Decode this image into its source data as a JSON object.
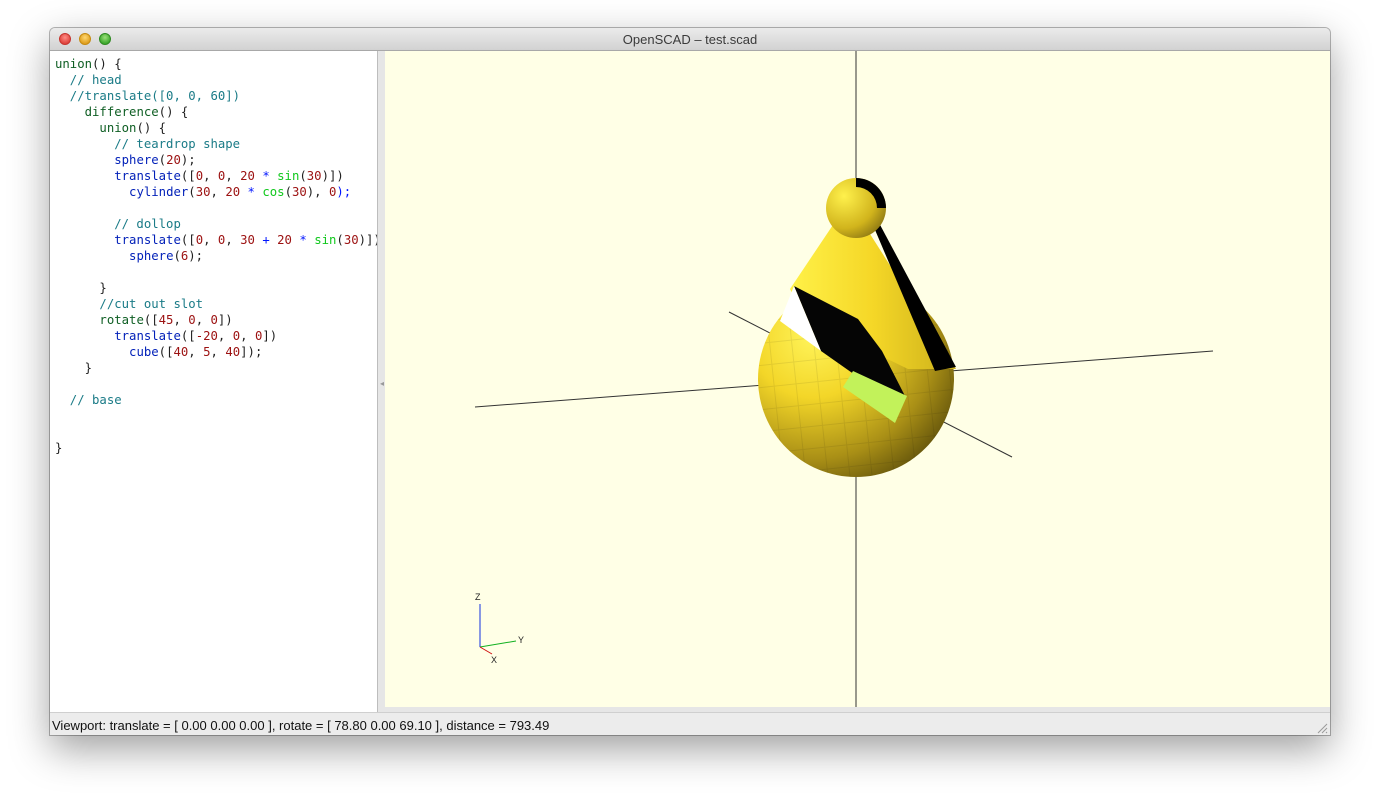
{
  "window": {
    "title": "OpenSCAD – test.scad"
  },
  "editor": {
    "lines": [
      [
        {
          "t": "union",
          "c": "kw"
        },
        {
          "t": "() {",
          "c": "tx"
        }
      ],
      [
        {
          "t": "  // head",
          "c": "cm"
        }
      ],
      [
        {
          "t": "  //translate([0, 0, 60])",
          "c": "cm"
        }
      ],
      [
        {
          "t": "    ",
          "c": "tx"
        },
        {
          "t": "difference",
          "c": "kw"
        },
        {
          "t": "() {",
          "c": "tx"
        }
      ],
      [
        {
          "t": "      ",
          "c": "tx"
        },
        {
          "t": "union",
          "c": "kw"
        },
        {
          "t": "() {",
          "c": "tx"
        }
      ],
      [
        {
          "t": "        // teardrop shape",
          "c": "cm"
        }
      ],
      [
        {
          "t": "        ",
          "c": "tx"
        },
        {
          "t": "sphere",
          "c": "fn"
        },
        {
          "t": "(",
          "c": "tx"
        },
        {
          "t": "20",
          "c": "nm"
        },
        {
          "t": ");",
          "c": "tx"
        }
      ],
      [
        {
          "t": "        ",
          "c": "tx"
        },
        {
          "t": "translate",
          "c": "fn"
        },
        {
          "t": "([",
          "c": "tx"
        },
        {
          "t": "0",
          "c": "nm"
        },
        {
          "t": ", ",
          "c": "tx"
        },
        {
          "t": "0",
          "c": "nm"
        },
        {
          "t": ", ",
          "c": "tx"
        },
        {
          "t": "20",
          "c": "nm"
        },
        {
          "t": " ",
          "c": "tx"
        },
        {
          "t": "*",
          "c": "op"
        },
        {
          "t": " ",
          "c": "tx"
        },
        {
          "t": "sin",
          "c": "mt"
        },
        {
          "t": "(",
          "c": "tx"
        },
        {
          "t": "30",
          "c": "nm"
        },
        {
          "t": ")])",
          "c": "tx"
        }
      ],
      [
        {
          "t": "          ",
          "c": "tx"
        },
        {
          "t": "cylinder",
          "c": "fn"
        },
        {
          "t": "(",
          "c": "tx"
        },
        {
          "t": "30",
          "c": "nm"
        },
        {
          "t": ", ",
          "c": "tx"
        },
        {
          "t": "20",
          "c": "nm"
        },
        {
          "t": " ",
          "c": "tx"
        },
        {
          "t": "*",
          "c": "op"
        },
        {
          "t": " ",
          "c": "tx"
        },
        {
          "t": "cos",
          "c": "mt"
        },
        {
          "t": "(",
          "c": "tx"
        },
        {
          "t": "30",
          "c": "nm"
        },
        {
          "t": "), ",
          "c": "tx"
        },
        {
          "t": "0",
          "c": "nm"
        },
        {
          "t": ");",
          "c": "op"
        }
      ],
      [
        {
          "t": "",
          "c": "tx"
        }
      ],
      [
        {
          "t": "        // dollop",
          "c": "cm"
        }
      ],
      [
        {
          "t": "        ",
          "c": "tx"
        },
        {
          "t": "translate",
          "c": "fn"
        },
        {
          "t": "([",
          "c": "tx"
        },
        {
          "t": "0",
          "c": "nm"
        },
        {
          "t": ", ",
          "c": "tx"
        },
        {
          "t": "0",
          "c": "nm"
        },
        {
          "t": ", ",
          "c": "tx"
        },
        {
          "t": "30",
          "c": "nm"
        },
        {
          "t": " ",
          "c": "tx"
        },
        {
          "t": "+",
          "c": "op"
        },
        {
          "t": " ",
          "c": "tx"
        },
        {
          "t": "20",
          "c": "nm"
        },
        {
          "t": " ",
          "c": "tx"
        },
        {
          "t": "*",
          "c": "op"
        },
        {
          "t": " ",
          "c": "tx"
        },
        {
          "t": "sin",
          "c": "mt"
        },
        {
          "t": "(",
          "c": "tx"
        },
        {
          "t": "30",
          "c": "nm"
        },
        {
          "t": ")])",
          "c": "tx"
        }
      ],
      [
        {
          "t": "          ",
          "c": "tx"
        },
        {
          "t": "sphere",
          "c": "fn"
        },
        {
          "t": "(",
          "c": "tx"
        },
        {
          "t": "6",
          "c": "nm"
        },
        {
          "t": ");",
          "c": "tx"
        }
      ],
      [
        {
          "t": "",
          "c": "tx"
        }
      ],
      [
        {
          "t": "      }",
          "c": "tx"
        }
      ],
      [
        {
          "t": "      //cut out slot",
          "c": "cm"
        }
      ],
      [
        {
          "t": "      ",
          "c": "tx"
        },
        {
          "t": "rotate",
          "c": "kw"
        },
        {
          "t": "([",
          "c": "tx"
        },
        {
          "t": "45",
          "c": "nm"
        },
        {
          "t": ", ",
          "c": "tx"
        },
        {
          "t": "0",
          "c": "nm"
        },
        {
          "t": ", ",
          "c": "tx"
        },
        {
          "t": "0",
          "c": "nm"
        },
        {
          "t": "])",
          "c": "tx"
        }
      ],
      [
        {
          "t": "        ",
          "c": "tx"
        },
        {
          "t": "translate",
          "c": "fn"
        },
        {
          "t": "([",
          "c": "tx"
        },
        {
          "t": "-20",
          "c": "nm"
        },
        {
          "t": ", ",
          "c": "tx"
        },
        {
          "t": "0",
          "c": "nm"
        },
        {
          "t": ", ",
          "c": "tx"
        },
        {
          "t": "0",
          "c": "nm"
        },
        {
          "t": "])",
          "c": "tx"
        }
      ],
      [
        {
          "t": "          ",
          "c": "tx"
        },
        {
          "t": "cube",
          "c": "fn"
        },
        {
          "t": "([",
          "c": "tx"
        },
        {
          "t": "40",
          "c": "nm"
        },
        {
          "t": ", ",
          "c": "tx"
        },
        {
          "t": "5",
          "c": "nm"
        },
        {
          "t": ", ",
          "c": "tx"
        },
        {
          "t": "40",
          "c": "nm"
        },
        {
          "t": "]);",
          "c": "tx"
        }
      ],
      [
        {
          "t": "    }",
          "c": "tx"
        }
      ],
      [
        {
          "t": "",
          "c": "tx"
        }
      ],
      [
        {
          "t": "  // base",
          "c": "cm"
        }
      ],
      [
        {
          "t": "",
          "c": "tx"
        }
      ],
      [
        {
          "t": "",
          "c": "tx"
        }
      ],
      [
        {
          "t": "}",
          "c": "tx"
        }
      ]
    ]
  },
  "viewport": {
    "background": "#ffffe6",
    "model_color": "#f9e231",
    "cut_face_color": "#c2f25a",
    "axis_labels": {
      "z": "Z",
      "y": "Y",
      "x": "X"
    }
  },
  "status_bar": {
    "text": "Viewport: translate = [ 0.00 0.00 0.00 ], rotate = [ 78.80 0.00 69.10 ], distance = 793.49"
  }
}
